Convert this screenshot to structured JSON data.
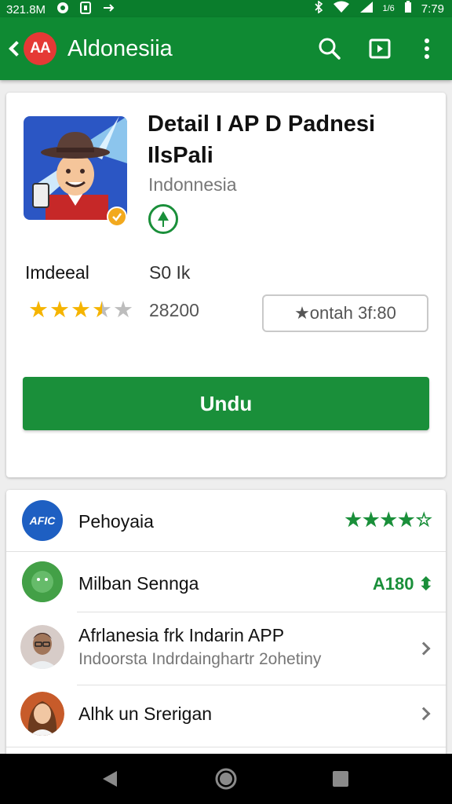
{
  "status_bar": {
    "left_text": "321.8M",
    "time": "7:79",
    "signal_text": "1/6"
  },
  "app_bar": {
    "logo_text": "AA",
    "title": "Aldonesiia",
    "accent_color": "#0f8a33",
    "icons": [
      "back-arrow-icon",
      "search-icon",
      "cast-icon",
      "more-vert-icon"
    ]
  },
  "detail": {
    "app_name": "Detail I AP D Padnesi IlsPali",
    "developer": "Indonnesia",
    "stat_label": "Imdeeal",
    "stat_value": "S0 Ik",
    "rating": 3.5,
    "review_count": "28200",
    "secondary_button": "★ontah 3f:80",
    "primary_button": "Undu",
    "button_color": "#1a8f3a"
  },
  "list": {
    "items": [
      {
        "title": "Pehoyaia",
        "avatar_text": "AFIC",
        "trailing": "★★★★☆"
      },
      {
        "title": "Milban Senngа",
        "trailing": "A180 ⬍"
      },
      {
        "title": "Afrlanesia frk Indarin APP",
        "subtitle": "Indoorsta Indrdainghartr 2ohetiny"
      },
      {
        "title": "Alhk un Srerigan"
      }
    ]
  }
}
